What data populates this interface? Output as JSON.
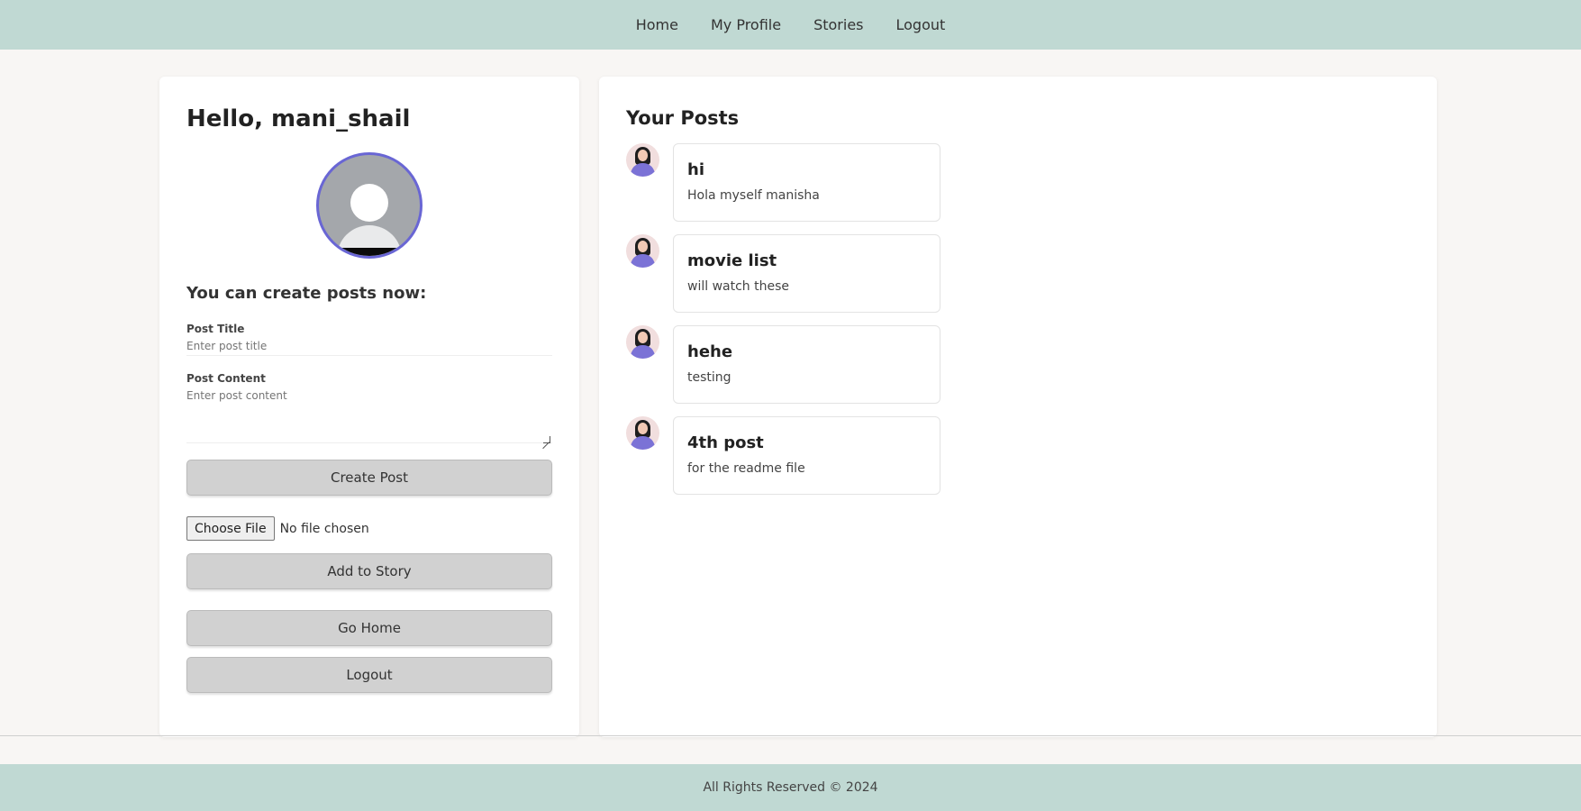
{
  "nav": {
    "items": [
      {
        "label": "Home"
      },
      {
        "label": "My Profile"
      },
      {
        "label": "Stories"
      },
      {
        "label": "Logout"
      }
    ]
  },
  "profile": {
    "greeting": "Hello, mani_shail",
    "create_heading": "You can create posts now:",
    "form": {
      "title_label": "Post Title",
      "title_placeholder": "Enter post title",
      "content_label": "Post Content",
      "content_placeholder": "Enter post content",
      "create_button": "Create Post"
    },
    "file": {
      "choose_label": "Choose File",
      "status": "No file chosen"
    },
    "buttons": {
      "story": "Add to Story",
      "home": "Go Home",
      "logout": "Logout"
    },
    "accent_color": "#6966d4"
  },
  "posts": {
    "heading": "Your Posts",
    "items": [
      {
        "title": "hi",
        "content": "Hola myself manisha"
      },
      {
        "title": "movie list",
        "content": "will watch these"
      },
      {
        "title": "hehe",
        "content": "testing"
      },
      {
        "title": "4th post",
        "content": "for the readme file"
      }
    ]
  },
  "footer": {
    "text": "All Rights Reserved © 2024",
    "color": "#c0d9d3"
  }
}
